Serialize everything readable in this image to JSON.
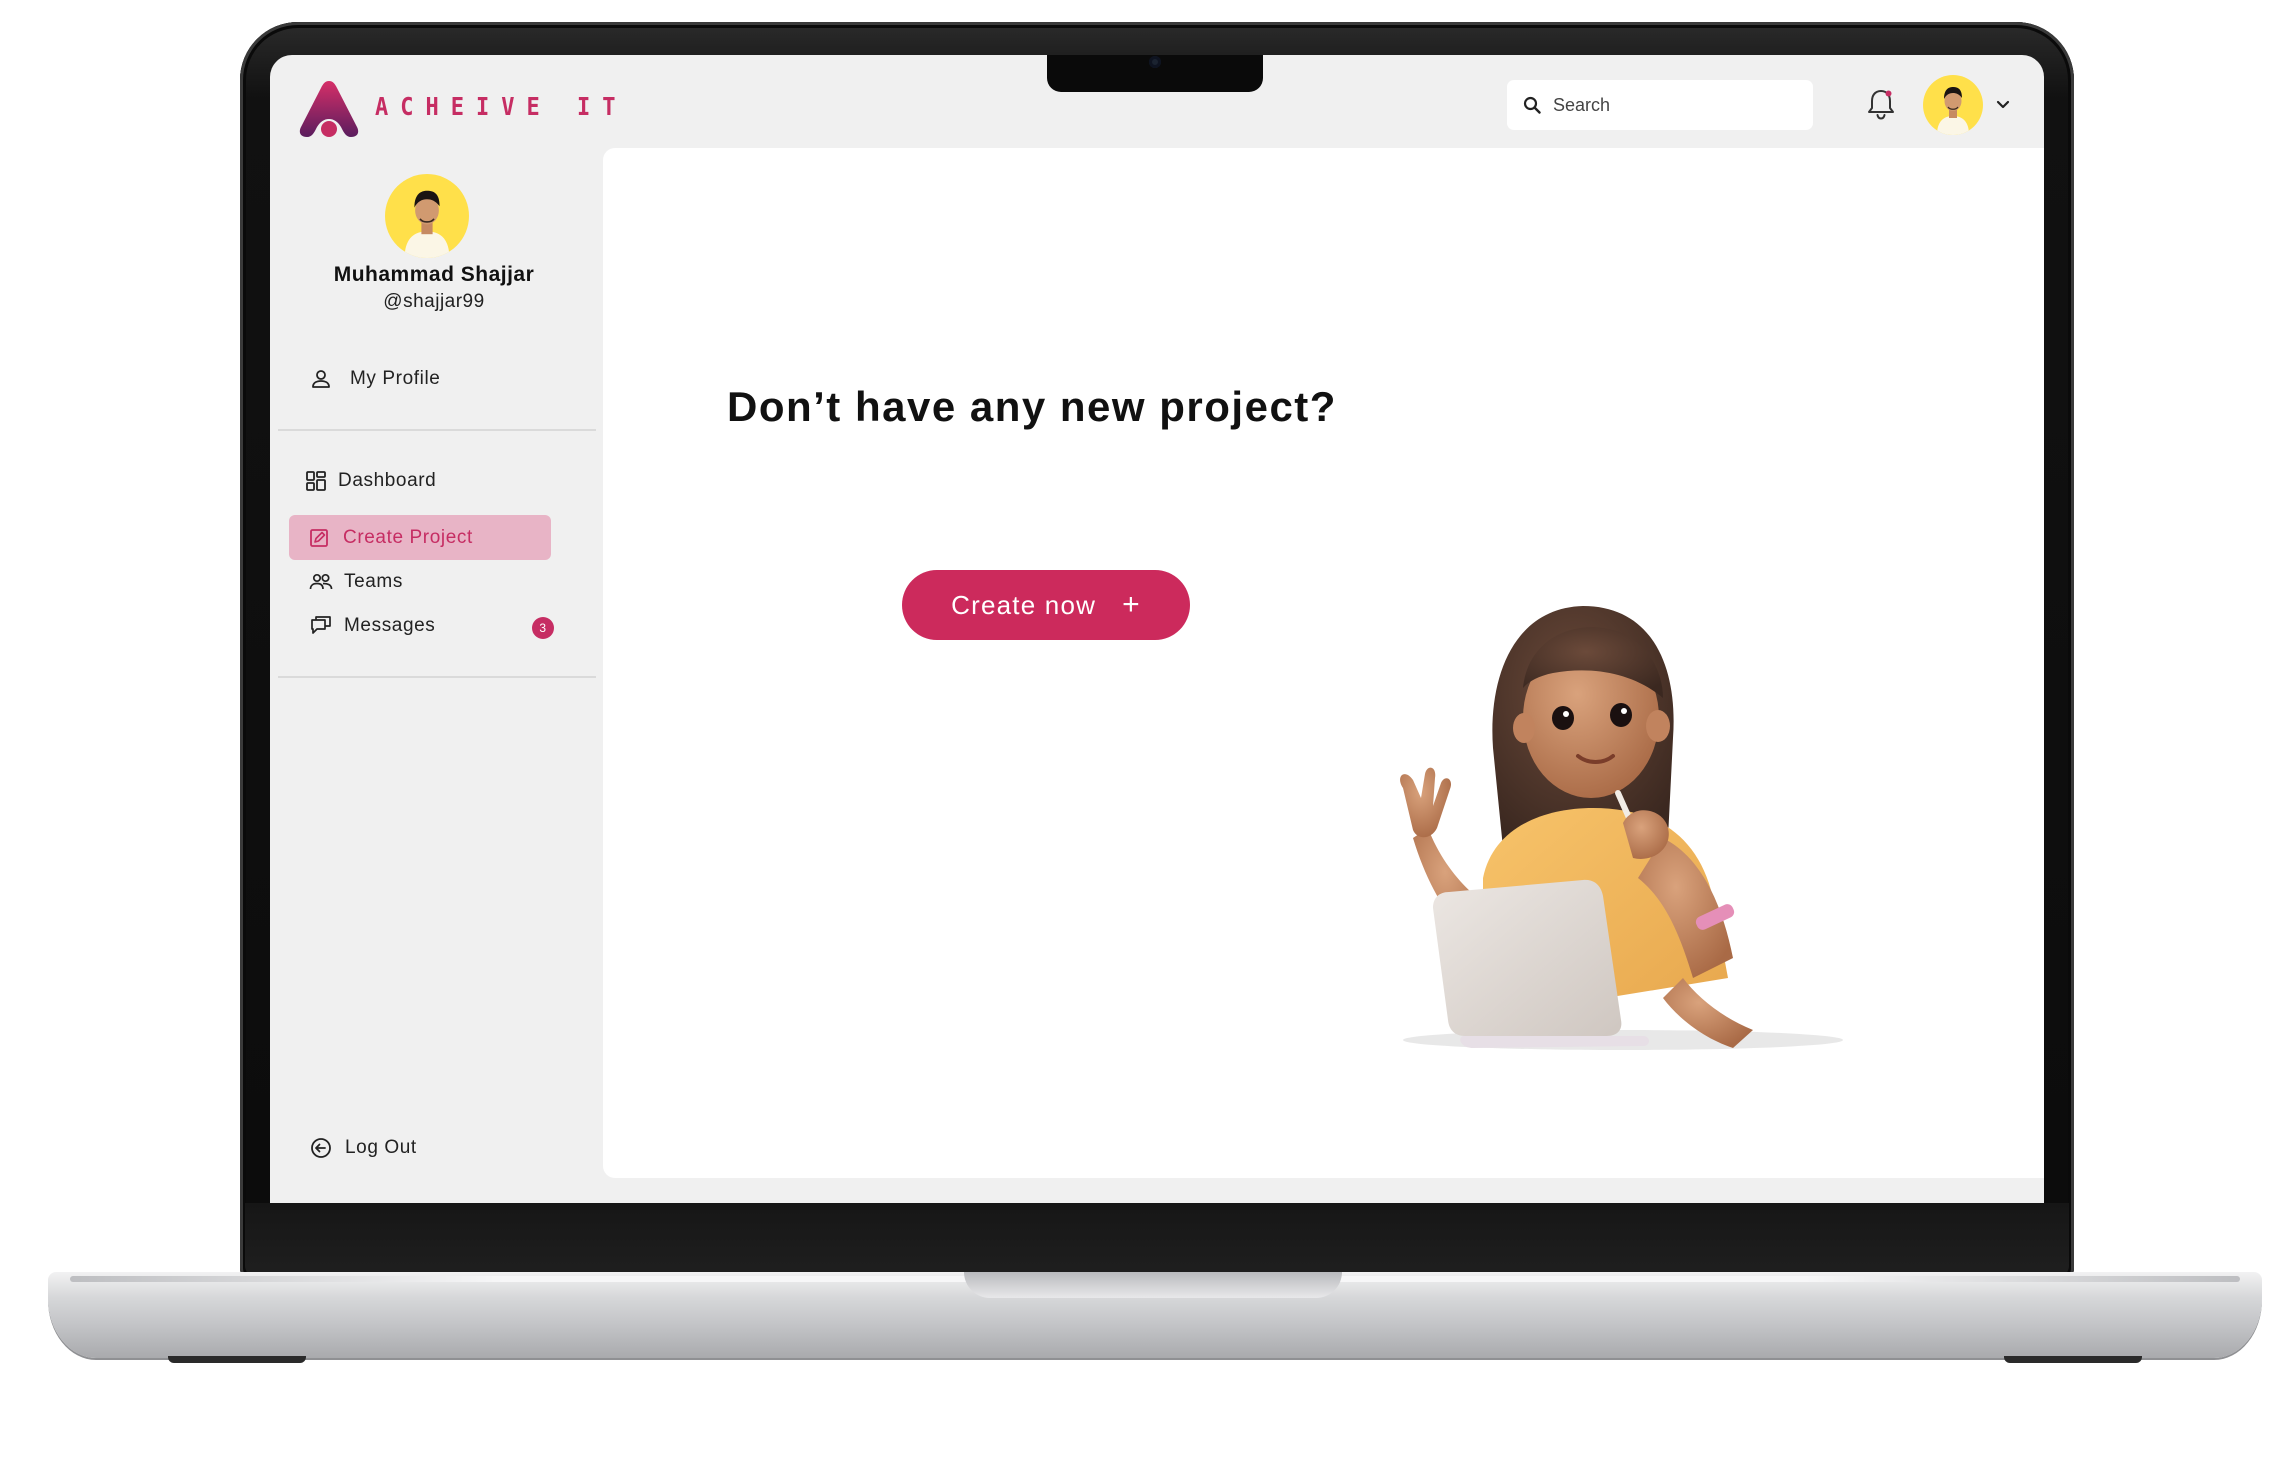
{
  "app": {
    "logo_text": "ACHEIVE IT"
  },
  "header": {
    "search_placeholder": "Search"
  },
  "user": {
    "name": "Muhammad Shajjar",
    "handle": "@shajjar99"
  },
  "sidebar": {
    "profile_label": "My Profile",
    "items": [
      {
        "label": "Dashboard"
      },
      {
        "label": "Create Project",
        "active": true
      },
      {
        "label": "Teams"
      },
      {
        "label": "Messages",
        "badge": "3"
      }
    ],
    "logout_label": "Log Out"
  },
  "main": {
    "headline": "Don’t have any new project?",
    "cta_label": "Create now",
    "cta_icon": "+"
  },
  "colors": {
    "accent": "#c62d63",
    "active_bg": "#e8b4c6",
    "app_bg": "#f0f0f0",
    "avatar_bg": "#ffe04a"
  },
  "icons": [
    "logo-mark",
    "search-icon",
    "bell-icon",
    "chevron-down-icon",
    "user-icon",
    "dashboard-icon",
    "edit-icon",
    "teams-icon",
    "messages-icon",
    "logout-icon",
    "plus-icon"
  ]
}
